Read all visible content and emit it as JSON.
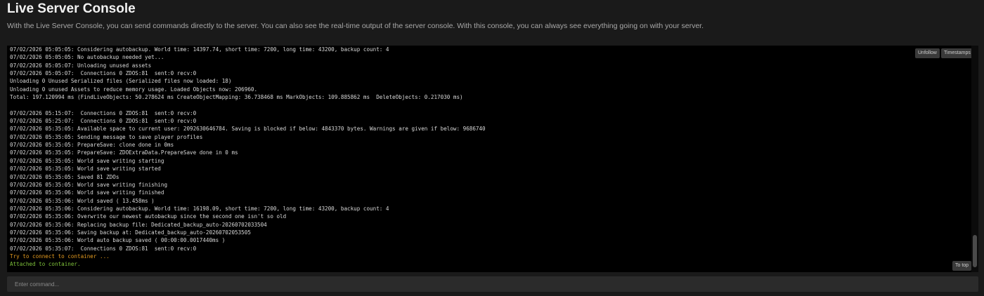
{
  "header": {
    "title": "Live Server Console",
    "subtitle": "With the Live Server Console, you can send commands directly to the server. You can also see the real-time output of the server console. With this console, you can always see everything going on with your server."
  },
  "console": {
    "buttons": {
      "unfollow_label": "Unfollow",
      "timestamps_label": "Timestamps",
      "to_top_label": "To top"
    },
    "scroll_position": 0.86,
    "lines": [
      {
        "text": "07/02/2026 05:05:05: Considering autobackup. World time: 14397.74, short time: 7200, long time: 43200, backup count: 4",
        "style": "normal"
      },
      {
        "text": "07/02/2026 05:05:05: No autobackup needed yet...",
        "style": "normal"
      },
      {
        "text": "07/02/2026 05:05:07: Unloading unused assets",
        "style": "normal"
      },
      {
        "text": "07/02/2026 05:05:07:  Connections 0 ZDOS:81  sent:0 recv:0",
        "style": "normal"
      },
      {
        "text": "Unloading 0 Unused Serialized files (Serialized files now loaded: 18)",
        "style": "normal"
      },
      {
        "text": "Unloading 0 unused Assets to reduce memory usage. Loaded Objects now: 206960.",
        "style": "normal"
      },
      {
        "text": "Total: 197.120994 ms (FindLiveObjects: 50.278624 ms CreateObjectMapping: 36.738468 ms MarkObjects: 109.885862 ms  DeleteObjects: 0.217030 ms)",
        "style": "normal"
      },
      {
        "text": "",
        "style": "normal"
      },
      {
        "text": "07/02/2026 05:15:07:  Connections 0 ZDOS:81  sent:0 recv:0",
        "style": "normal"
      },
      {
        "text": "07/02/2026 05:25:07:  Connections 0 ZDOS:81  sent:0 recv:0",
        "style": "normal"
      },
      {
        "text": "07/02/2026 05:35:05: Available space to current user: 2092630646784. Saving is blocked if below: 4843370 bytes. Warnings are given if below: 9686740",
        "style": "normal"
      },
      {
        "text": "07/02/2026 05:35:05: Sending message to save player profiles",
        "style": "normal"
      },
      {
        "text": "07/02/2026 05:35:05: PrepareSave: clone done in 0ms",
        "style": "normal"
      },
      {
        "text": "07/02/2026 05:35:05: PrepareSave: ZDOExtraData.PrepareSave done in 0 ms",
        "style": "normal"
      },
      {
        "text": "07/02/2026 05:35:05: World save writing starting",
        "style": "normal"
      },
      {
        "text": "07/02/2026 05:35:05: World save writing started",
        "style": "normal"
      },
      {
        "text": "07/02/2026 05:35:05: Saved 81 ZDOs",
        "style": "normal"
      },
      {
        "text": "07/02/2026 05:35:05: World save writing finishing",
        "style": "normal"
      },
      {
        "text": "07/02/2026 05:35:06: World save writing finished",
        "style": "normal"
      },
      {
        "text": "07/02/2026 05:35:06: World saved ( 13.458ms )",
        "style": "normal"
      },
      {
        "text": "07/02/2026 05:35:06: Considering autobackup. World time: 16198.09, short time: 7200, long time: 43200, backup count: 4",
        "style": "normal"
      },
      {
        "text": "07/02/2026 05:35:06: Overwrite our newest autobackup since the second one isn't so old",
        "style": "normal"
      },
      {
        "text": "07/02/2026 05:35:06: Replacing backup file: Dedicated_backup_auto-20260702033504",
        "style": "normal"
      },
      {
        "text": "07/02/2026 05:35:06: Saving backup at: Dedicated_backup_auto-20260702053505",
        "style": "normal"
      },
      {
        "text": "07/02/2026 05:35:06: World auto backup saved ( 00:00:00.0017440ms )",
        "style": "normal"
      },
      {
        "text": "07/02/2026 05:35:07:  Connections 0 ZDOS:81  sent:0 recv:0",
        "style": "normal"
      },
      {
        "text": "Try to connect to container ...",
        "style": "warn"
      },
      {
        "text": "Attached to container.",
        "style": "ok"
      }
    ]
  },
  "command": {
    "placeholder": "Enter command..."
  },
  "colors": {
    "warn": "#e39a1f",
    "ok": "#7ec23a",
    "background": "#1a1a1a",
    "console_background": "#000000"
  }
}
